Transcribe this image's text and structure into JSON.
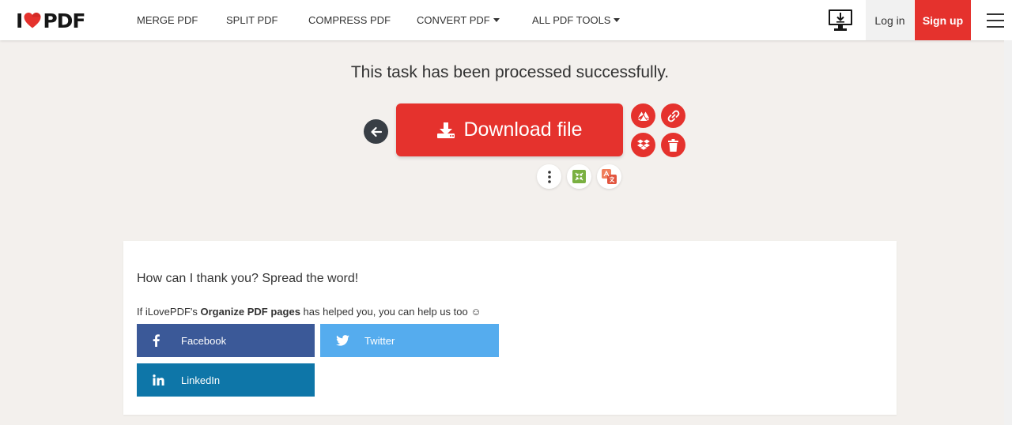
{
  "header": {
    "logo": {
      "prefix": "I",
      "suffix": "PDF"
    },
    "nav": [
      {
        "label": "MERGE PDF",
        "dropdown": false
      },
      {
        "label": "SPLIT PDF",
        "dropdown": false
      },
      {
        "label": "COMPRESS PDF",
        "dropdown": false
      },
      {
        "label": "CONVERT PDF",
        "dropdown": true
      },
      {
        "label": "ALL PDF TOOLS",
        "dropdown": true
      }
    ],
    "login_label": "Log in",
    "signup_label": "Sign up"
  },
  "main": {
    "success_message": "This task has been processed successfully.",
    "download_label": "Download file"
  },
  "share": {
    "title": "How can I thank you? Spread the word!",
    "sub_before": "If iLovePDF's ",
    "sub_bold": "Organize PDF pages",
    "sub_after": " has helped you, you can help us too ☺",
    "facebook_label": "Facebook",
    "twitter_label": "Twitter",
    "linkedin_label": "LinkedIn"
  },
  "colors": {
    "brand_red": "#e5322d",
    "facebook": "#3b5998",
    "twitter": "#55acee",
    "linkedin": "#0e76a8",
    "dark": "#383e45"
  }
}
